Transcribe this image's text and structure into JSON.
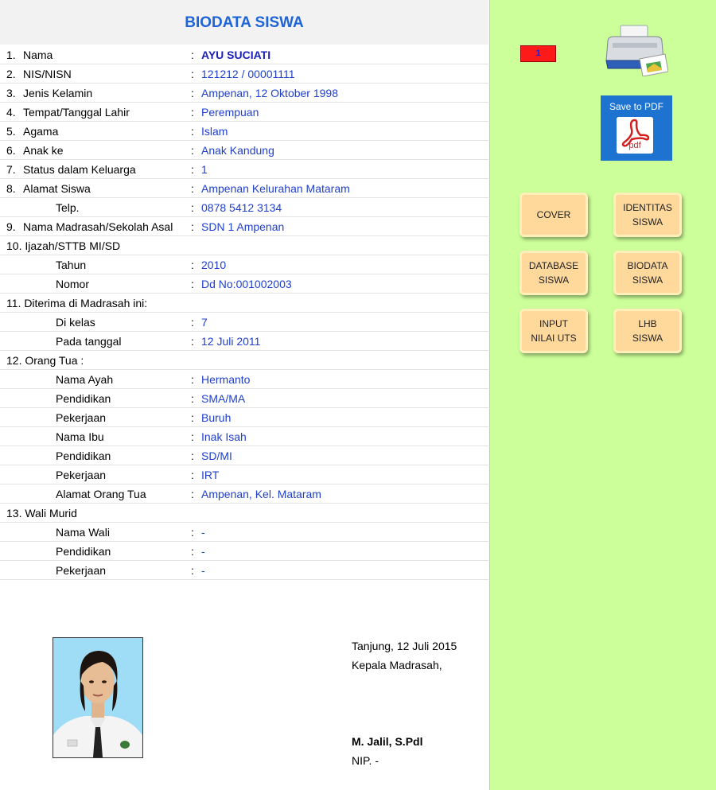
{
  "title": "BIODATA SISWA",
  "rows": [
    {
      "num": "1.",
      "label": "Nama",
      "indent": 1,
      "value": "AYU SUCIATI",
      "bold": true
    },
    {
      "num": "2.",
      "label": "NIS/NISN",
      "indent": 1,
      "value": "121212 / 00001111"
    },
    {
      "num": "3.",
      "label": "Jenis Kelamin",
      "indent": 1,
      "value": "Ampenan, 12 Oktober 1998"
    },
    {
      "num": "4.",
      "label": "Tempat/Tanggal Lahir",
      "indent": 1,
      "value": "Perempuan"
    },
    {
      "num": "5.",
      "label": "Agama",
      "indent": 1,
      "value": "Islam"
    },
    {
      "num": "6.",
      "label": "Anak ke",
      "indent": 1,
      "value": "Anak Kandung"
    },
    {
      "num": "7.",
      "label": "Status dalam Keluarga",
      "indent": 1,
      "value": "1"
    },
    {
      "num": "8.",
      "label": "Alamat Siswa",
      "indent": 1,
      "value": "Ampenan Kelurahan Mataram"
    },
    {
      "num": "",
      "label": "Telp.",
      "indent": 2,
      "value": "0878 5412 3134"
    },
    {
      "num": "9.",
      "label": "Nama Madrasah/Sekolah Asal",
      "indent": 1,
      "value": "SDN 1 Ampenan"
    },
    {
      "num": "",
      "label": "10. Ijazah/STTB MI/SD",
      "indent": 0,
      "value": null
    },
    {
      "num": "",
      "label": "Tahun",
      "indent": 2,
      "value": "2010"
    },
    {
      "num": "",
      "label": "Nomor",
      "indent": 2,
      "value": "Dd No:001002003"
    },
    {
      "num": "",
      "label": "11. Diterima di Madrasah ini:",
      "indent": 0,
      "value": null
    },
    {
      "num": "",
      "label": "Di kelas",
      "indent": 2,
      "value": "7"
    },
    {
      "num": "",
      "label": "Pada tanggal",
      "indent": 2,
      "value": "12 Juli 2011"
    },
    {
      "num": "",
      "label": "12. Orang Tua :",
      "indent": 0,
      "value": null
    },
    {
      "num": "",
      "label": "Nama Ayah",
      "indent": 2,
      "value": "Hermanto"
    },
    {
      "num": "",
      "label": "Pendidikan",
      "indent": 2,
      "value": "SMA/MA"
    },
    {
      "num": "",
      "label": "Pekerjaan",
      "indent": 2,
      "value": "Buruh"
    },
    {
      "num": "",
      "label": "Nama Ibu",
      "indent": 2,
      "value": "Inak Isah"
    },
    {
      "num": "",
      "label": "Pendidikan",
      "indent": 2,
      "value": "SD/MI"
    },
    {
      "num": "",
      "label": "Pekerjaan",
      "indent": 2,
      "value": "IRT"
    },
    {
      "num": "",
      "label": "Alamat Orang Tua",
      "indent": 2,
      "value": "Ampenan, Kel. Mataram"
    },
    {
      "num": "",
      "label": "13. Wali Murid",
      "indent": 0,
      "value": null
    },
    {
      "num": "",
      "label": "Nama Wali",
      "indent": 2,
      "value": "-"
    },
    {
      "num": "",
      "label": "Pendidikan",
      "indent": 2,
      "value": "-"
    },
    {
      "num": "",
      "label": "Pekerjaan",
      "indent": 2,
      "value": "-"
    }
  ],
  "colon": ":",
  "signature": {
    "place_date": "Tanjung, 12 Juli 2015",
    "position": "Kepala Madrasah,",
    "name": "M. Jalil, S.Pdl",
    "nip": "NIP. -"
  },
  "panel": {
    "page_indicator": "1",
    "save_pdf_label": "Save to PDF",
    "pdf_icon_text": "pdf",
    "buttons": [
      {
        "id": "cover",
        "label": "COVER"
      },
      {
        "id": "identitas-siswa",
        "label": "IDENTITAS\nSISWA"
      },
      {
        "id": "database-siswa",
        "label": "DATABASE\nSISWA"
      },
      {
        "id": "biodata-siswa",
        "label": "BIODATA\nSISWA"
      },
      {
        "id": "input-nilai-uts",
        "label": "INPUT\nNILAI UTS"
      },
      {
        "id": "lhb-siswa",
        "label": "LHB\nSISWA"
      }
    ]
  },
  "colors": {
    "accent_title": "#1e64d8",
    "value_text": "#1f3fcc",
    "panel_bg": "#ccff99",
    "nav_button": "#ffd89b",
    "pdf_button": "#1e73d0"
  }
}
